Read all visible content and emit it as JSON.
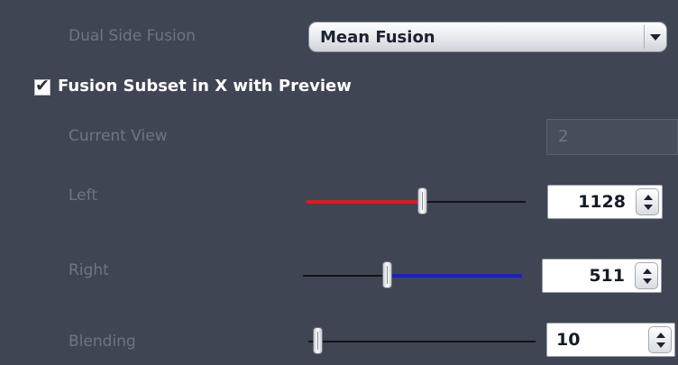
{
  "dual_side_fusion": {
    "label": "Dual Side Fusion",
    "selected": "Mean Fusion"
  },
  "fusion_subset": {
    "label": "Fusion Subset in X with Preview",
    "checked": true
  },
  "current_view": {
    "label": "Current View",
    "value": "2"
  },
  "left": {
    "label": "Left",
    "value": "1128",
    "slider_fraction": 0.53,
    "fill_color": "#e8141c"
  },
  "right": {
    "label": "Right",
    "value": "511",
    "slider_fraction": 0.38,
    "fill_color": "#1d1fc8"
  },
  "blending": {
    "label": "Blending",
    "value": "10",
    "slider_fraction": 0.02
  },
  "icons": {
    "dropdown": "chevron-down-icon",
    "check": "checkmark-icon",
    "spin_up": "arrow-up-icon",
    "spin_down": "arrow-down-icon"
  }
}
